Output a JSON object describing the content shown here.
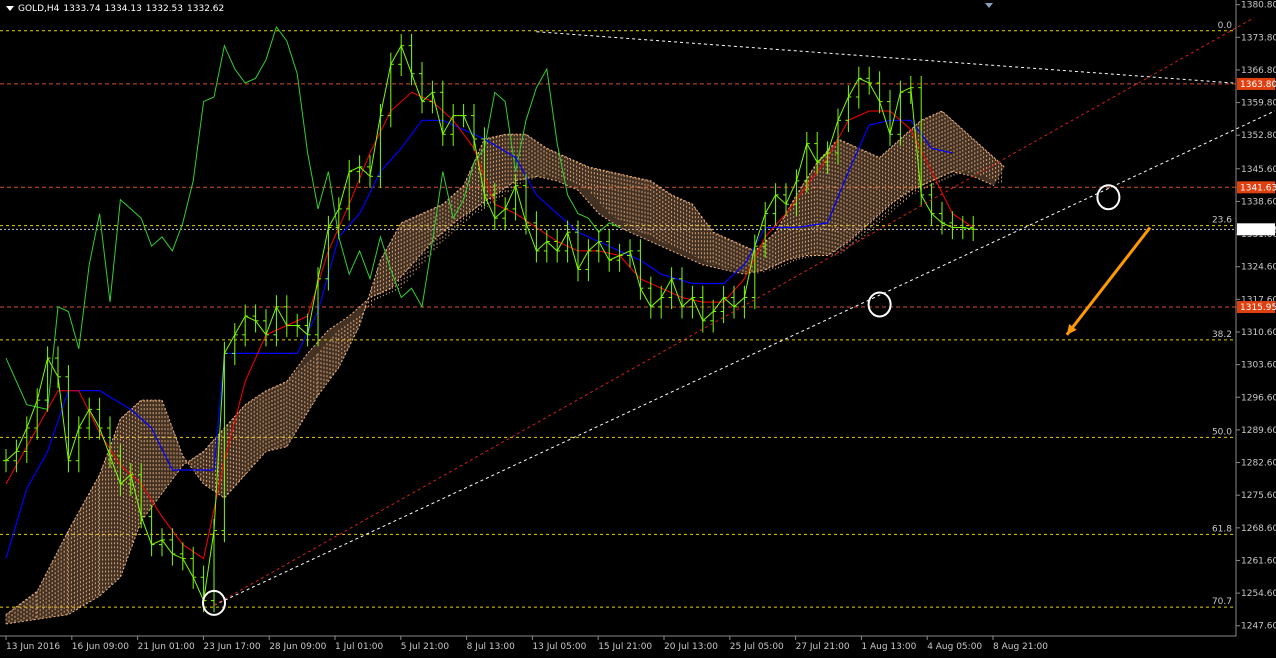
{
  "header": {
    "symbol": "GOLD,H4",
    "open": "1333.74",
    "high": "1334.13",
    "low": "1332.53",
    "close": "1332.62"
  },
  "colors": {
    "background": "#000000",
    "price": "#7cfc00",
    "chikou": "#32cd32",
    "tenkan": "#ff0000",
    "kijun": "#0000ff",
    "kumo": "#f0b482",
    "hline_red": "#d0502a",
    "hline_yellow": "#e6d200",
    "trend_white": "#ffffff",
    "trend_red": "#d02020",
    "arrow": "#ff9900",
    "price_tag": "#e04010",
    "current_tag": "#ffffff"
  },
  "chart_data": {
    "type": "line",
    "symbol": "GOLD,H4",
    "xlabels": [
      "13 Jun 2016",
      "16 Jun 09:00",
      "21 Jun 01:00",
      "23 Jun 17:00",
      "28 Jun 09:00",
      "1 Jul 01:00",
      "5 Jul 21:00",
      "8 Jul 13:00",
      "13 Jul 05:00",
      "15 Jul 21:00",
      "20 Jul 13:00",
      "25 Jul 05:00",
      "27 Jul 21:00",
      "1 Aug 13:00",
      "4 Aug 05:00",
      "8 Aug 21:00"
    ],
    "yticks": [
      "1380.80",
      "1373.80",
      "1366.80",
      "1359.80",
      "1352.80",
      "1345.60",
      "1338.60",
      "1331.60",
      "1324.60",
      "1317.60",
      "1310.60",
      "1303.60",
      "1296.60",
      "1289.60",
      "1282.60",
      "1275.60",
      "1268.60",
      "1261.60",
      "1254.60",
      "1247.60"
    ],
    "ylim": [
      1245.4,
      1381.8
    ],
    "price_tags": [
      {
        "value": 1363.8,
        "text": "1363.80"
      },
      {
        "value": 1341.63,
        "text": "1341.63"
      },
      {
        "value": 1315.95,
        "text": "1315.95"
      }
    ],
    "current_price": {
      "value": 1332.62,
      "text": "1332.62"
    },
    "fibonacci": [
      {
        "label": "0.0",
        "value": 1375.2
      },
      {
        "label": "23.6",
        "value": 1333.4
      },
      {
        "label": "38.2",
        "value": 1308.9
      },
      {
        "label": "50.0",
        "value": 1288.0
      },
      {
        "label": "61.8",
        "value": 1267.2
      },
      {
        "label": "70.7",
        "value": 1251.6
      }
    ],
    "price_series": [
      [
        0,
        1283
      ],
      [
        1,
        1285
      ],
      [
        2,
        1290
      ],
      [
        3,
        1296
      ],
      [
        4,
        1305
      ],
      [
        5,
        1301
      ],
      [
        6,
        1283
      ],
      [
        7,
        1290
      ],
      [
        8,
        1294
      ],
      [
        9,
        1290
      ],
      [
        10,
        1284
      ],
      [
        11,
        1278
      ],
      [
        12,
        1280
      ],
      [
        13,
        1271
      ],
      [
        14,
        1265
      ],
      [
        15,
        1266
      ],
      [
        16,
        1263
      ],
      [
        17,
        1262
      ],
      [
        18,
        1258
      ],
      [
        19,
        1253
      ],
      [
        20,
        1268
      ],
      [
        21,
        1306
      ],
      [
        22,
        1310
      ],
      [
        23,
        1314
      ],
      [
        24,
        1313
      ],
      [
        25,
        1310
      ],
      [
        26,
        1316
      ],
      [
        27,
        1312
      ],
      [
        28,
        1312
      ],
      [
        29,
        1310
      ],
      [
        30,
        1322
      ],
      [
        31,
        1333
      ],
      [
        32,
        1337
      ],
      [
        33,
        1345
      ],
      [
        34,
        1346
      ],
      [
        35,
        1344
      ],
      [
        36,
        1357
      ],
      [
        37,
        1368
      ],
      [
        38,
        1372
      ],
      [
        39,
        1366
      ],
      [
        40,
        1360
      ],
      [
        41,
        1362
      ],
      [
        42,
        1353
      ],
      [
        43,
        1357
      ],
      [
        44,
        1357
      ],
      [
        45,
        1352
      ],
      [
        46,
        1340
      ],
      [
        47,
        1335
      ],
      [
        48,
        1337
      ],
      [
        49,
        1342
      ],
      [
        50,
        1334
      ],
      [
        51,
        1328
      ],
      [
        52,
        1330
      ],
      [
        53,
        1328
      ],
      [
        54,
        1332
      ],
      [
        55,
        1324
      ],
      [
        56,
        1328
      ],
      [
        57,
        1330
      ],
      [
        58,
        1326
      ],
      [
        59,
        1327
      ],
      [
        60,
        1328
      ],
      [
        61,
        1320
      ],
      [
        62,
        1316
      ],
      [
        63,
        1318
      ],
      [
        64,
        1322
      ],
      [
        65,
        1316
      ],
      [
        66,
        1318
      ],
      [
        67,
        1313
      ],
      [
        68,
        1315
      ],
      [
        69,
        1318
      ],
      [
        70,
        1316
      ],
      [
        71,
        1318
      ],
      [
        72,
        1329
      ],
      [
        73,
        1336
      ],
      [
        74,
        1340
      ],
      [
        75,
        1338
      ],
      [
        76,
        1343
      ],
      [
        77,
        1351
      ],
      [
        78,
        1347
      ],
      [
        79,
        1349
      ],
      [
        80,
        1356
      ],
      [
        81,
        1361
      ],
      [
        82,
        1365
      ],
      [
        83,
        1364
      ],
      [
        84,
        1360
      ],
      [
        85,
        1353
      ],
      [
        86,
        1362
      ],
      [
        87,
        1363
      ],
      [
        88,
        1340
      ],
      [
        89,
        1336
      ],
      [
        90,
        1334
      ],
      [
        91,
        1333
      ],
      [
        92,
        1333
      ],
      [
        93,
        1332.62
      ]
    ],
    "chikou_series": [
      [
        0,
        1305
      ],
      [
        2,
        1295
      ],
      [
        4,
        1294
      ],
      [
        5,
        1316
      ],
      [
        6,
        1315
      ],
      [
        7,
        1307
      ],
      [
        8,
        1325
      ],
      [
        9,
        1336
      ],
      [
        10,
        1317
      ],
      [
        11,
        1339
      ],
      [
        12,
        1337
      ],
      [
        13,
        1335
      ],
      [
        14,
        1329
      ],
      [
        15,
        1331
      ],
      [
        16,
        1328
      ],
      [
        17,
        1334
      ],
      [
        18,
        1343
      ],
      [
        19,
        1360
      ],
      [
        20,
        1361
      ],
      [
        21,
        1372
      ],
      [
        22,
        1367
      ],
      [
        23,
        1364
      ],
      [
        24,
        1365
      ],
      [
        25,
        1369
      ],
      [
        26,
        1376
      ],
      [
        27,
        1373
      ],
      [
        28,
        1366
      ],
      [
        29,
        1349
      ],
      [
        30,
        1337
      ],
      [
        31,
        1345
      ],
      [
        32,
        1331
      ],
      [
        33,
        1323
      ],
      [
        34,
        1328
      ],
      [
        35,
        1322
      ],
      [
        36,
        1331
      ],
      [
        37,
        1324
      ],
      [
        38,
        1318
      ],
      [
        39,
        1320
      ],
      [
        40,
        1316
      ],
      [
        41,
        1330
      ],
      [
        42,
        1345
      ],
      [
        43,
        1335
      ],
      [
        44,
        1339
      ],
      [
        45,
        1347
      ],
      [
        46,
        1350
      ],
      [
        47,
        1362
      ],
      [
        48,
        1360
      ],
      [
        49,
        1345
      ],
      [
        50,
        1356
      ],
      [
        51,
        1363
      ],
      [
        52,
        1367
      ],
      [
        53,
        1351
      ],
      [
        54,
        1340
      ],
      [
        55,
        1336
      ],
      [
        56,
        1335
      ],
      [
        57,
        1332
      ],
      [
        58,
        1334
      ],
      [
        59,
        1333
      ]
    ],
    "tenkan_series": [
      [
        0,
        1278
      ],
      [
        3,
        1290
      ],
      [
        5,
        1298
      ],
      [
        7,
        1298
      ],
      [
        9,
        1289
      ],
      [
        11,
        1282
      ],
      [
        13,
        1278
      ],
      [
        15,
        1271
      ],
      [
        17,
        1265
      ],
      [
        19,
        1262
      ],
      [
        21,
        1283
      ],
      [
        23,
        1300
      ],
      [
        25,
        1310
      ],
      [
        27,
        1312
      ],
      [
        29,
        1314
      ],
      [
        31,
        1328
      ],
      [
        33,
        1338
      ],
      [
        35,
        1349
      ],
      [
        37,
        1358
      ],
      [
        39,
        1362
      ],
      [
        41,
        1360
      ],
      [
        43,
        1356
      ],
      [
        45,
        1350
      ],
      [
        47,
        1338
      ],
      [
        49,
        1336
      ],
      [
        51,
        1333
      ],
      [
        53,
        1330
      ],
      [
        55,
        1328
      ],
      [
        57,
        1328
      ],
      [
        59,
        1327
      ],
      [
        61,
        1322
      ],
      [
        63,
        1320
      ],
      [
        65,
        1318
      ],
      [
        67,
        1317
      ],
      [
        69,
        1317
      ],
      [
        71,
        1322
      ],
      [
        73,
        1331
      ],
      [
        75,
        1336
      ],
      [
        77,
        1342
      ],
      [
        79,
        1348
      ],
      [
        81,
        1356
      ],
      [
        83,
        1358
      ],
      [
        85,
        1358
      ],
      [
        87,
        1354
      ],
      [
        89,
        1345
      ],
      [
        91,
        1336
      ],
      [
        93,
        1333
      ]
    ],
    "kijun_series": [
      [
        0,
        1262
      ],
      [
        2,
        1277
      ],
      [
        4,
        1285
      ],
      [
        6,
        1298
      ],
      [
        9,
        1298
      ],
      [
        12,
        1294
      ],
      [
        14,
        1290
      ],
      [
        16,
        1281
      ],
      [
        18,
        1281
      ],
      [
        20,
        1281
      ],
      [
        21,
        1306
      ],
      [
        24,
        1306
      ],
      [
        28,
        1306
      ],
      [
        30,
        1315
      ],
      [
        32,
        1331
      ],
      [
        34,
        1336
      ],
      [
        36,
        1345
      ],
      [
        38,
        1350
      ],
      [
        40,
        1356
      ],
      [
        42,
        1356
      ],
      [
        44,
        1354
      ],
      [
        46,
        1352
      ],
      [
        49,
        1348
      ],
      [
        51,
        1340
      ],
      [
        53,
        1336
      ],
      [
        55,
        1332
      ],
      [
        57,
        1330
      ],
      [
        59,
        1328
      ],
      [
        61,
        1326
      ],
      [
        63,
        1323
      ],
      [
        66,
        1321
      ],
      [
        69,
        1321
      ],
      [
        71,
        1325
      ],
      [
        73,
        1333
      ],
      [
        76,
        1333
      ],
      [
        79,
        1334
      ],
      [
        81,
        1345
      ],
      [
        83,
        1355
      ],
      [
        85,
        1356
      ],
      [
        87,
        1356
      ],
      [
        89,
        1350
      ],
      [
        91,
        1349
      ]
    ],
    "kumo_upper": [
      [
        0,
        1250
      ],
      [
        3,
        1255
      ],
      [
        6,
        1268
      ],
      [
        9,
        1280
      ],
      [
        11,
        1292
      ],
      [
        13,
        1296
      ],
      [
        15,
        1296
      ],
      [
        17,
        1284
      ],
      [
        19,
        1278
      ],
      [
        21,
        1275
      ],
      [
        23,
        1280
      ],
      [
        25,
        1285
      ],
      [
        27,
        1286
      ],
      [
        30,
        1297
      ],
      [
        32,
        1303
      ],
      [
        34,
        1312
      ],
      [
        36,
        1326
      ],
      [
        38,
        1334
      ],
      [
        40,
        1336
      ],
      [
        42,
        1338
      ],
      [
        44,
        1342
      ],
      [
        46,
        1352
      ],
      [
        48,
        1353
      ],
      [
        50,
        1353
      ],
      [
        52,
        1350
      ],
      [
        54,
        1348
      ],
      [
        56,
        1346
      ],
      [
        58,
        1345
      ],
      [
        60,
        1344
      ],
      [
        62,
        1343
      ],
      [
        64,
        1340
      ],
      [
        66,
        1338
      ],
      [
        68,
        1332
      ],
      [
        70,
        1330
      ],
      [
        72,
        1328
      ],
      [
        74,
        1332
      ],
      [
        76,
        1340
      ],
      [
        78,
        1347
      ],
      [
        80,
        1352
      ],
      [
        82,
        1350
      ],
      [
        84,
        1348
      ],
      [
        86,
        1352
      ],
      [
        88,
        1356
      ],
      [
        90,
        1358
      ],
      [
        92,
        1354
      ],
      [
        94,
        1350
      ],
      [
        96,
        1346
      ]
    ],
    "kumo_lower": [
      [
        0,
        1248
      ],
      [
        3,
        1249
      ],
      [
        6,
        1250
      ],
      [
        9,
        1254
      ],
      [
        11,
        1258
      ],
      [
        13,
        1270
      ],
      [
        15,
        1276
      ],
      [
        17,
        1282
      ],
      [
        19,
        1285
      ],
      [
        21,
        1290
      ],
      [
        23,
        1295
      ],
      [
        25,
        1298
      ],
      [
        27,
        1300
      ],
      [
        29,
        1306
      ],
      [
        31,
        1311
      ],
      [
        33,
        1314
      ],
      [
        35,
        1318
      ],
      [
        37,
        1320
      ],
      [
        39,
        1325
      ],
      [
        41,
        1330
      ],
      [
        43,
        1334
      ],
      [
        45,
        1337
      ],
      [
        47,
        1340
      ],
      [
        49,
        1343
      ],
      [
        51,
        1344
      ],
      [
        53,
        1343
      ],
      [
        55,
        1341
      ],
      [
        57,
        1336
      ],
      [
        59,
        1333
      ],
      [
        61,
        1331
      ],
      [
        63,
        1329
      ],
      [
        65,
        1327
      ],
      [
        67,
        1325
      ],
      [
        69,
        1324
      ],
      [
        71,
        1323
      ],
      [
        73,
        1324
      ],
      [
        75,
        1326
      ],
      [
        77,
        1327
      ],
      [
        79,
        1327
      ],
      [
        81,
        1330
      ],
      [
        83,
        1334
      ],
      [
        85,
        1338
      ],
      [
        87,
        1341
      ],
      [
        89,
        1343
      ],
      [
        91,
        1345
      ],
      [
        93,
        1344
      ],
      [
        95,
        1342
      ]
    ],
    "trendlines": [
      {
        "type": "dashed-white",
        "from": [
          20,
          1252
        ],
        "to": [
          122,
          1358
        ]
      },
      {
        "type": "dashed-red",
        "from": [
          20,
          1252
        ],
        "to": [
          120,
          1378
        ]
      },
      {
        "type": "dashed-white",
        "from": [
          51,
          1375
        ],
        "to": [
          118,
          1364
        ]
      }
    ],
    "circles": [
      {
        "x": 20,
        "value": 1252.5
      },
      {
        "x": 84,
        "value": 1316.5
      },
      {
        "x": 106,
        "value": 1339.5
      }
    ],
    "arrow": {
      "from": [
        110,
        1333
      ],
      "to": [
        102,
        1310
      ]
    }
  }
}
